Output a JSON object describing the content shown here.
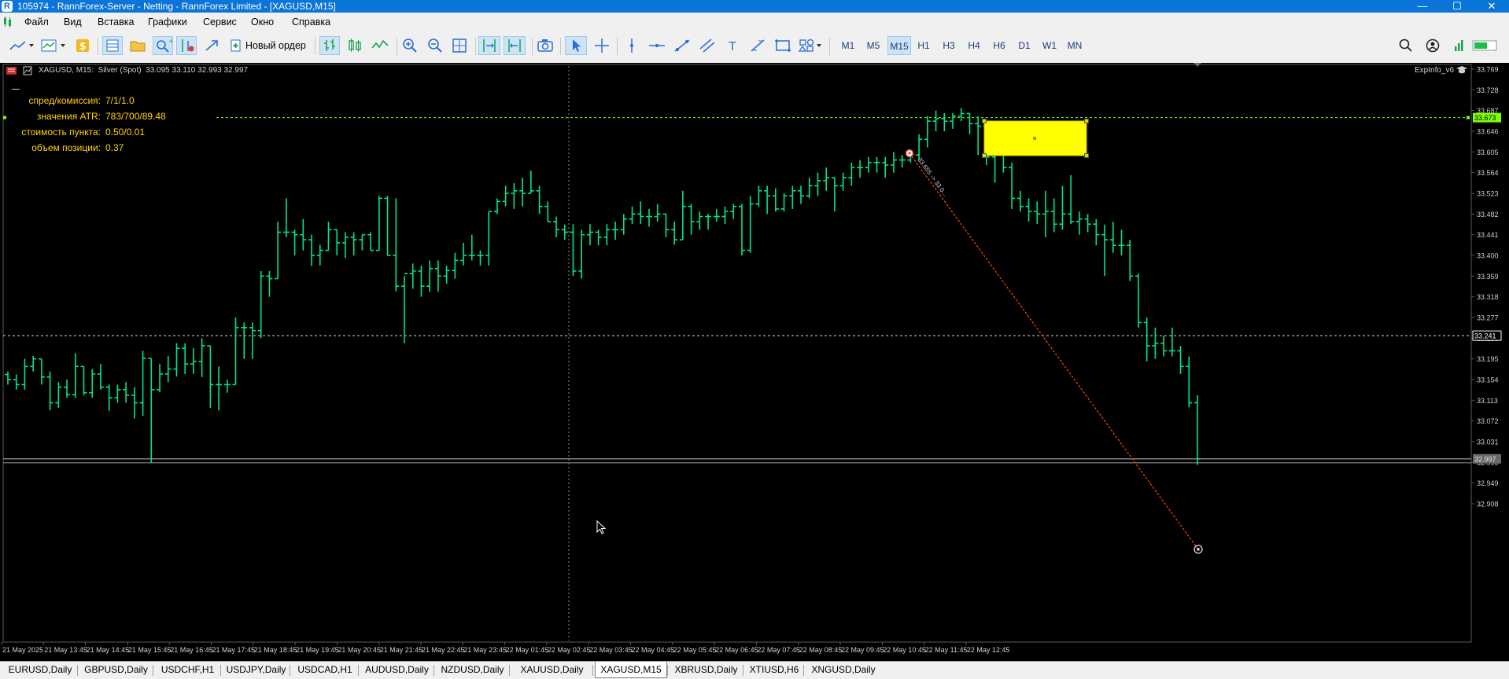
{
  "window": {
    "title": "105974 - RannForex-Server - Netting - RannForex Limited - [XAGUSD,M15]",
    "minimize": "—",
    "maximize": "☐",
    "close": "✕"
  },
  "menu": [
    "Файл",
    "Вид",
    "Вставка",
    "Графики",
    "Сервис",
    "Окно",
    "Справка"
  ],
  "toolbar": {
    "new_order_label": "Новый ордер",
    "timeframes": [
      "M1",
      "M5",
      "M15",
      "H1",
      "H3",
      "H4",
      "H6",
      "D1",
      "W1",
      "MN"
    ],
    "active_timeframe": "M15"
  },
  "chart": {
    "header": "XAGUSD, M15:  Silver (Spot)  33.095 33.110 32.993 32.997",
    "indicator_name": "ExpInfo_v6",
    "info_panel": [
      {
        "label": "спред/комиссия:",
        "value": "7/1/1.0"
      },
      {
        "label": "значения ATR:",
        "value": "783/700/89.48"
      },
      {
        "label": "стоимость пункта:",
        "value": "0.50/0.01"
      },
      {
        "label": "объем позиции:",
        "value": "0.37"
      }
    ],
    "trendline_label": "33.655 -> 33.0...",
    "price_axis": [
      "33.769",
      "33.728",
      "33.687",
      "33.646",
      "33.605",
      "33.564",
      "33.523",
      "33.482",
      "33.441",
      "33.400",
      "33.359",
      "33.318",
      "33.277",
      "33.236",
      "33.195",
      "33.154",
      "33.113",
      "33.072",
      "33.031",
      "32.990",
      "32.949",
      "32.908"
    ],
    "level_green_label": "33.673",
    "level_white_label": "33.241",
    "bid_label": "32.997",
    "time_axis": [
      "21 May 2025",
      "21 May 13:45",
      "21 May 14:45",
      "21 May 15:45",
      "21 May 16:45",
      "21 May 17:45",
      "21 May 18:45",
      "21 May 19:45",
      "21 May 20:45",
      "21 May 21:45",
      "21 May 22:45",
      "21 May 23:45",
      "22 May 01:45",
      "22 May 02:45",
      "22 May 03:45",
      "22 May 04:45",
      "22 May 05:45",
      "22 May 06:45",
      "22 May 07:45",
      "22 May 08:45",
      "22 May 09:45",
      "22 May 10:45",
      "22 May 11:45",
      "22 May 12:45"
    ],
    "colors": {
      "bars": "#00e58a",
      "background": "#000000",
      "axis_text": "#cfcfcf",
      "info_text": "#ffd400",
      "green_level": "#7fff00",
      "rectangle": "#ffff00",
      "trendline": "#ff4500"
    }
  },
  "chart_data": {
    "type": "ohlc",
    "symbol": "XAGUSD",
    "timeframe": "M15",
    "description": "Silver (Spot)",
    "ohlc": [
      33.095,
      33.11,
      32.993,
      32.997
    ],
    "ylim": [
      32.88,
      33.79
    ],
    "levels": [
      33.673,
      33.241,
      32.997
    ],
    "bars": [
      [
        33.164,
        33.17,
        33.144,
        33.154
      ],
      [
        33.154,
        33.164,
        33.134,
        33.144
      ],
      [
        33.144,
        33.195,
        33.134,
        33.18
      ],
      [
        33.18,
        33.201,
        33.17,
        33.195
      ],
      [
        33.195,
        33.195,
        33.144,
        33.159
      ],
      [
        33.159,
        33.17,
        33.093,
        33.108
      ],
      [
        33.108,
        33.149,
        33.098,
        33.139
      ],
      [
        33.139,
        33.154,
        33.118,
        33.124
      ],
      [
        33.124,
        33.206,
        33.118,
        33.18
      ],
      [
        33.18,
        33.18,
        33.123,
        33.128
      ],
      [
        33.128,
        33.175,
        33.118,
        33.165
      ],
      [
        33.165,
        33.185,
        33.134,
        33.139
      ],
      [
        33.139,
        33.144,
        33.092,
        33.118
      ],
      [
        33.118,
        33.144,
        33.108,
        33.134
      ],
      [
        33.134,
        33.149,
        33.108,
        33.123
      ],
      [
        33.123,
        33.139,
        33.077,
        33.108
      ],
      [
        33.108,
        33.211,
        33.082,
        33.196
      ],
      [
        33.196,
        33.196,
        32.99,
        33.134
      ],
      [
        33.134,
        33.185,
        33.129,
        33.165
      ],
      [
        33.165,
        33.201,
        33.149,
        33.175
      ],
      [
        33.175,
        33.226,
        33.16,
        33.216
      ],
      [
        33.216,
        33.226,
        33.165,
        33.185
      ],
      [
        33.185,
        33.216,
        33.165,
        33.19
      ],
      [
        33.19,
        33.236,
        33.159,
        33.221
      ],
      [
        33.221,
        33.221,
        33.098,
        33.144
      ],
      [
        33.144,
        33.18,
        33.093,
        33.144
      ],
      [
        33.144,
        33.154,
        33.128,
        33.144
      ],
      [
        33.144,
        33.277,
        33.144,
        33.257
      ],
      [
        33.257,
        33.267,
        33.195,
        33.257
      ],
      [
        33.257,
        33.267,
        33.195,
        33.251
      ],
      [
        33.251,
        33.369,
        33.236,
        33.359
      ],
      [
        33.359,
        33.369,
        33.318,
        33.354
      ],
      [
        33.354,
        33.467,
        33.354,
        33.446
      ],
      [
        33.446,
        33.513,
        33.436,
        33.446
      ],
      [
        33.446,
        33.451,
        33.4,
        33.441
      ],
      [
        33.441,
        33.472,
        33.41,
        33.431
      ],
      [
        33.431,
        33.441,
        33.379,
        33.4
      ],
      [
        33.4,
        33.421,
        33.38,
        33.41
      ],
      [
        33.41,
        33.467,
        33.41,
        33.451
      ],
      [
        33.451,
        33.451,
        33.4,
        33.425
      ],
      [
        33.425,
        33.446,
        33.395,
        33.436
      ],
      [
        33.436,
        33.446,
        33.4,
        33.431
      ],
      [
        33.431,
        33.441,
        33.41,
        33.441
      ],
      [
        33.441,
        33.446,
        33.41,
        33.41
      ],
      [
        33.41,
        33.518,
        33.41,
        33.513
      ],
      [
        33.513,
        33.518,
        33.4,
        33.4
      ],
      [
        33.4,
        33.513,
        33.329,
        33.339
      ],
      [
        33.339,
        33.359,
        33.226,
        33.364
      ],
      [
        33.364,
        33.384,
        33.334,
        33.369
      ],
      [
        33.369,
        33.38,
        33.318,
        33.339
      ],
      [
        33.339,
        33.39,
        33.328,
        33.374
      ],
      [
        33.374,
        33.39,
        33.328,
        33.359
      ],
      [
        33.359,
        33.38,
        33.344,
        33.37
      ],
      [
        33.37,
        33.405,
        33.354,
        33.39
      ],
      [
        33.39,
        33.425,
        33.38,
        33.4
      ],
      [
        33.4,
        33.441,
        33.39,
        33.4
      ],
      [
        33.4,
        33.41,
        33.38,
        33.4
      ],
      [
        33.4,
        33.487,
        33.38,
        33.487
      ],
      [
        33.487,
        33.513,
        33.482,
        33.507
      ],
      [
        33.507,
        33.538,
        33.497,
        33.523
      ],
      [
        33.523,
        33.543,
        33.492,
        33.528
      ],
      [
        33.528,
        33.554,
        33.497,
        33.523
      ],
      [
        33.523,
        33.568,
        33.523,
        33.528
      ],
      [
        33.528,
        33.538,
        33.482,
        33.497
      ],
      [
        33.497,
        33.507,
        33.467,
        33.467
      ],
      [
        33.467,
        33.477,
        33.436,
        33.451
      ],
      [
        33.451,
        33.461,
        33.431,
        33.446
      ],
      [
        33.446,
        33.462,
        33.359,
        33.369
      ],
      [
        33.369,
        33.451,
        33.354,
        33.441
      ],
      [
        33.441,
        33.462,
        33.42,
        33.446
      ],
      [
        33.446,
        33.451,
        33.42,
        33.436
      ],
      [
        33.436,
        33.462,
        33.42,
        33.451
      ],
      [
        33.451,
        33.467,
        33.431,
        33.451
      ],
      [
        33.451,
        33.482,
        33.441,
        33.472
      ],
      [
        33.472,
        33.497,
        33.462,
        33.482
      ],
      [
        33.482,
        33.507,
        33.462,
        33.477
      ],
      [
        33.477,
        33.492,
        33.457,
        33.477
      ],
      [
        33.477,
        33.502,
        33.467,
        33.482
      ],
      [
        33.482,
        33.482,
        33.436,
        33.451
      ],
      [
        33.451,
        33.467,
        33.421,
        33.431
      ],
      [
        33.431,
        33.528,
        33.431,
        33.497
      ],
      [
        33.497,
        33.502,
        33.441,
        33.467
      ],
      [
        33.467,
        33.487,
        33.451,
        33.477
      ],
      [
        33.477,
        33.482,
        33.451,
        33.477
      ],
      [
        33.477,
        33.492,
        33.467,
        33.477
      ],
      [
        33.477,
        33.497,
        33.462,
        33.487
      ],
      [
        33.487,
        33.502,
        33.472,
        33.497
      ],
      [
        33.497,
        33.502,
        33.4,
        33.41
      ],
      [
        33.41,
        33.518,
        33.405,
        33.502
      ],
      [
        33.502,
        33.538,
        33.497,
        33.528
      ],
      [
        33.528,
        33.538,
        33.482,
        33.518
      ],
      [
        33.518,
        33.533,
        33.487,
        33.492
      ],
      [
        33.492,
        33.523,
        33.487,
        33.518
      ],
      [
        33.518,
        33.538,
        33.492,
        33.528
      ],
      [
        33.528,
        33.538,
        33.502,
        33.518
      ],
      [
        33.518,
        33.554,
        33.513,
        33.538
      ],
      [
        33.538,
        33.564,
        33.518,
        33.548
      ],
      [
        33.548,
        33.574,
        33.528,
        33.554
      ],
      [
        33.554,
        33.554,
        33.487,
        33.538
      ],
      [
        33.538,
        33.564,
        33.528,
        33.554
      ],
      [
        33.554,
        33.584,
        33.538,
        33.574
      ],
      [
        33.574,
        33.589,
        33.554,
        33.574
      ],
      [
        33.574,
        33.595,
        33.564,
        33.584
      ],
      [
        33.584,
        33.595,
        33.564,
        33.584
      ],
      [
        33.584,
        33.595,
        33.554,
        33.579
      ],
      [
        33.579,
        33.605,
        33.564,
        33.589
      ],
      [
        33.589,
        33.599,
        33.574,
        33.589
      ],
      [
        33.589,
        33.61,
        33.584,
        33.599
      ],
      [
        33.599,
        33.64,
        33.589,
        33.63
      ],
      [
        33.63,
        33.676,
        33.614,
        33.666
      ],
      [
        33.666,
        33.687,
        33.646,
        33.671
      ],
      [
        33.671,
        33.682,
        33.646,
        33.666
      ],
      [
        33.666,
        33.682,
        33.651,
        33.676
      ],
      [
        33.676,
        33.692,
        33.666,
        33.681
      ],
      [
        33.681,
        33.682,
        33.64,
        33.661
      ],
      [
        33.661,
        33.676,
        33.599,
        33.656
      ],
      [
        33.656,
        33.666,
        33.579,
        33.595
      ],
      [
        33.595,
        33.661,
        33.544,
        33.64
      ],
      [
        33.64,
        33.641,
        33.564,
        33.574
      ],
      [
        33.574,
        33.584,
        33.492,
        33.513
      ],
      [
        33.513,
        33.528,
        33.487,
        33.497
      ],
      [
        33.497,
        33.513,
        33.467,
        33.487
      ],
      [
        33.487,
        33.507,
        33.462,
        33.482
      ],
      [
        33.482,
        33.528,
        33.436,
        33.487
      ],
      [
        33.487,
        33.513,
        33.446,
        33.462
      ],
      [
        33.462,
        33.538,
        33.451,
        33.482
      ],
      [
        33.482,
        33.559,
        33.462,
        33.467
      ],
      [
        33.467,
        33.487,
        33.441,
        33.472
      ],
      [
        33.472,
        33.482,
        33.446,
        33.462
      ],
      [
        33.462,
        33.472,
        33.42,
        33.441
      ],
      [
        33.441,
        33.461,
        33.359,
        33.431
      ],
      [
        33.431,
        33.467,
        33.405,
        33.42
      ],
      [
        33.42,
        33.451,
        33.4,
        33.42
      ],
      [
        33.42,
        33.431,
        33.349,
        33.359
      ],
      [
        33.359,
        33.364,
        33.257,
        33.267
      ],
      [
        33.267,
        33.277,
        33.19,
        33.221
      ],
      [
        33.221,
        33.257,
        33.195,
        33.226
      ],
      [
        33.226,
        33.241,
        33.2,
        33.211
      ],
      [
        33.211,
        33.257,
        33.2,
        33.211
      ],
      [
        33.211,
        33.221,
        33.165,
        33.18
      ],
      [
        33.18,
        33.2,
        33.099,
        33.108
      ],
      [
        33.108,
        33.123,
        32.985,
        32.997
      ]
    ]
  },
  "tabs": [
    {
      "label": "EURUSD,Daily",
      "active": false
    },
    {
      "label": "GBPUSD,Daily",
      "active": false
    },
    {
      "label": "USDCHF,H1",
      "active": false
    },
    {
      "label": "USDJPY,Daily",
      "active": false
    },
    {
      "label": "USDCAD,H1",
      "active": false
    },
    {
      "label": "AUDUSD,Daily",
      "active": false
    },
    {
      "label": "NZDUSD,Daily",
      "active": false
    },
    {
      "label": "XAUUSD,Daily",
      "active": false
    },
    {
      "label": "XAGUSD,M15",
      "active": true
    },
    {
      "label": "XBRUSD,Daily",
      "active": false
    },
    {
      "label": "XTIUSD,H6",
      "active": false
    },
    {
      "label": "XNGUSD,Daily",
      "active": false
    }
  ]
}
